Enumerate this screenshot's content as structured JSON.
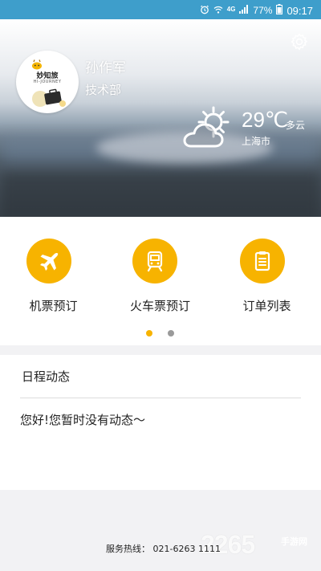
{
  "status_bar": {
    "network": "4G",
    "battery": "77%",
    "time": "09:17"
  },
  "profile": {
    "name": "孙作军",
    "department": "技术部",
    "avatar_logo_text": "妙知旅",
    "avatar_logo_sub": "HI-JOURNEY"
  },
  "weather": {
    "temperature": "29℃",
    "condition": "多云",
    "city": "上海市",
    "icon": "partly-cloudy-icon"
  },
  "services": [
    {
      "label": "机票预订",
      "icon": "airplane-icon"
    },
    {
      "label": "火车票预订",
      "icon": "train-icon"
    },
    {
      "label": "订单列表",
      "icon": "clipboard-icon"
    }
  ],
  "pager": {
    "count": 2,
    "active_index": 0
  },
  "schedule": {
    "title": "日程动态",
    "empty_message": "您好!您暂时没有动态～"
  },
  "footer": {
    "hotline": "服务热线： 021-6263 1111"
  },
  "watermark": {
    "number": "2265",
    "site": "手游网"
  },
  "colors": {
    "accent": "#f7b300",
    "status_bar": "#3e9ecb",
    "dot_active": "#f7b300",
    "dot_inactive": "#9a9a9a"
  }
}
